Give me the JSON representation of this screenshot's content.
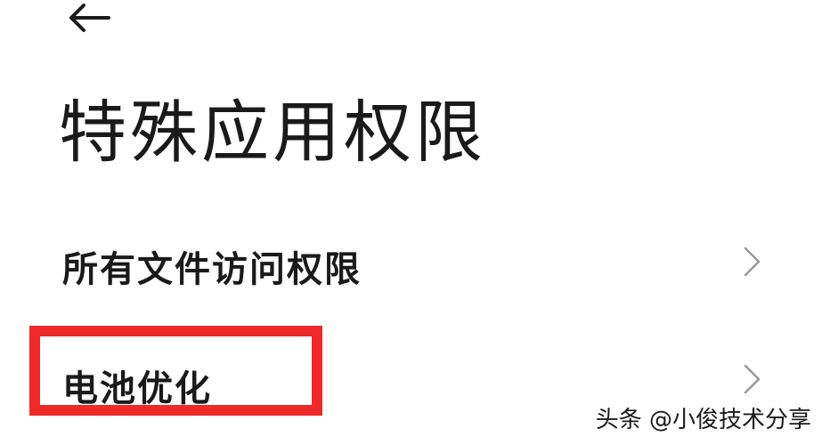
{
  "header": {
    "back_icon": "arrow-left-icon"
  },
  "page": {
    "title": "特殊应用权限"
  },
  "list": {
    "items": [
      {
        "label": "所有文件访问权限",
        "icon": "chevron-right-icon"
      },
      {
        "label": "电池优化",
        "icon": "chevron-right-icon",
        "highlighted": true
      }
    ]
  },
  "annotation": {
    "highlight_color": "#ee2a2a"
  },
  "watermark": {
    "text": "头条 @小俊技术分享"
  }
}
